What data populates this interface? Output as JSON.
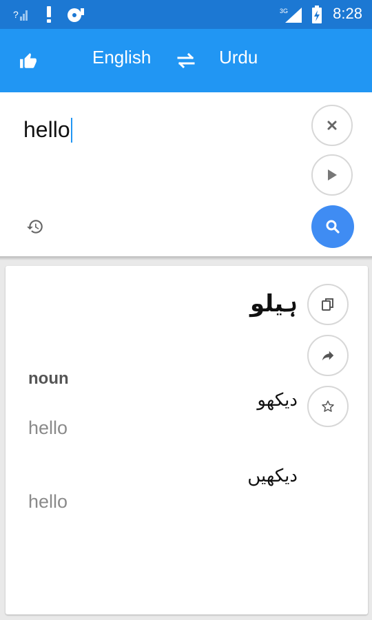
{
  "status_bar": {
    "time": "8:28",
    "network_label": "3G",
    "icons": [
      "signal-question-icon",
      "alert-icon",
      "cd-icon",
      "3g-signal-icon",
      "battery-charging-icon"
    ]
  },
  "app_bar": {
    "source_language": "English",
    "target_language": "Urdu",
    "icons": [
      "thumbs-up-icon",
      "swap-icon"
    ]
  },
  "input": {
    "text": "hello",
    "icons": [
      "close-icon",
      "play-icon",
      "history-icon",
      "search-icon"
    ]
  },
  "result": {
    "main_translation": "ہیلو",
    "part_of_speech": "noun",
    "entries": [
      {
        "urdu": "دیکھو",
        "english": "hello"
      },
      {
        "urdu": "دیکھیں",
        "english": "hello"
      }
    ],
    "icons": [
      "copy-icon",
      "share-icon",
      "star-icon"
    ]
  },
  "colors": {
    "status_bar": "#1c78d3",
    "app_bar": "#2196f3",
    "search_button": "#3f8cf3",
    "caret": "#2196f3"
  }
}
